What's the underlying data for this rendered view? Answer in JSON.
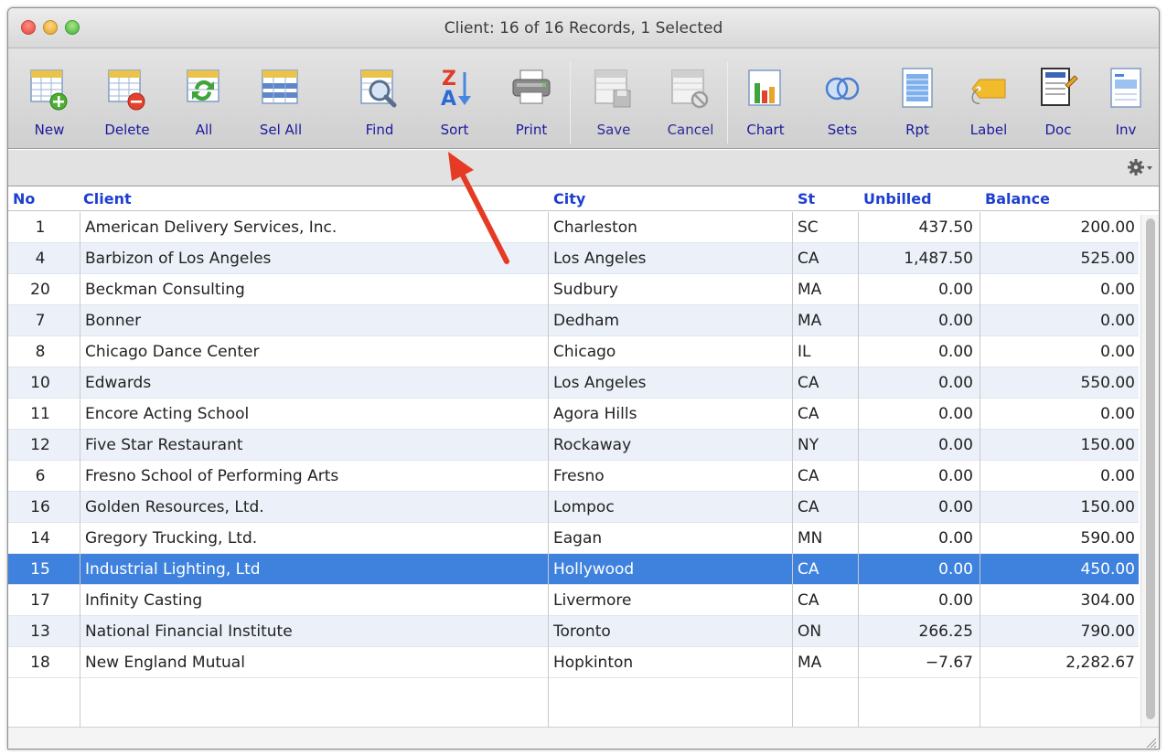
{
  "window": {
    "title": "Client: 16 of 16 Records, 1 Selected"
  },
  "toolbar": {
    "buttons": [
      {
        "label": "New",
        "icon": "new-record-icon"
      },
      {
        "label": "Delete",
        "icon": "delete-record-icon"
      },
      {
        "label": "All",
        "icon": "show-all-icon"
      },
      {
        "label": "Sel All",
        "icon": "select-all-icon"
      },
      {
        "label": "Find",
        "icon": "find-icon"
      },
      {
        "label": "Sort",
        "icon": "sort-az-icon"
      },
      {
        "label": "Print",
        "icon": "printer-icon"
      },
      {
        "label": "Save",
        "icon": "save-icon"
      },
      {
        "label": "Cancel",
        "icon": "cancel-icon"
      },
      {
        "label": "Chart",
        "icon": "chart-icon"
      },
      {
        "label": "Sets",
        "icon": "sets-icon"
      },
      {
        "label": "Rpt",
        "icon": "report-icon"
      },
      {
        "label": "Label",
        "icon": "label-tag-icon"
      },
      {
        "label": "Doc",
        "icon": "document-icon"
      },
      {
        "label": "Inv",
        "icon": "invoice-icon"
      }
    ]
  },
  "searchbar": {
    "gear_icon": "gear-icon"
  },
  "table": {
    "headers": [
      "No",
      "Client",
      "City",
      "St",
      "Unbilled",
      "Balance"
    ],
    "rows": [
      {
        "no": "1",
        "client": "American Delivery Services, Inc.",
        "city": "Charleston",
        "st": "SC",
        "unbilled": "437.50",
        "balance": "200.00"
      },
      {
        "no": "4",
        "client": "Barbizon of Los Angeles",
        "city": "Los Angeles",
        "st": "CA",
        "unbilled": "1,487.50",
        "balance": "525.00"
      },
      {
        "no": "20",
        "client": "Beckman Consulting",
        "city": "Sudbury",
        "st": "MA",
        "unbilled": "0.00",
        "balance": "0.00"
      },
      {
        "no": "7",
        "client": "Bonner",
        "city": "Dedham",
        "st": "MA",
        "unbilled": "0.00",
        "balance": "0.00"
      },
      {
        "no": "8",
        "client": "Chicago Dance Center",
        "city": "Chicago",
        "st": "IL",
        "unbilled": "0.00",
        "balance": "0.00"
      },
      {
        "no": "10",
        "client": "Edwards",
        "city": "Los Angeles",
        "st": "CA",
        "unbilled": "0.00",
        "balance": "550.00"
      },
      {
        "no": "11",
        "client": "Encore Acting School",
        "city": "Agora Hills",
        "st": "CA",
        "unbilled": "0.00",
        "balance": "0.00"
      },
      {
        "no": "12",
        "client": "Five Star Restaurant",
        "city": "Rockaway",
        "st": "NY",
        "unbilled": "0.00",
        "balance": "150.00"
      },
      {
        "no": "6",
        "client": "Fresno School of Performing Arts",
        "city": "Fresno",
        "st": "CA",
        "unbilled": "0.00",
        "balance": "0.00"
      },
      {
        "no": "16",
        "client": "Golden Resources, Ltd.",
        "city": "Lompoc",
        "st": "CA",
        "unbilled": "0.00",
        "balance": "150.00"
      },
      {
        "no": "14",
        "client": "Gregory Trucking, Ltd.",
        "city": "Eagan",
        "st": "MN",
        "unbilled": "0.00",
        "balance": "590.00"
      },
      {
        "no": "15",
        "client": "Industrial Lighting, Ltd",
        "city": "Hollywood",
        "st": "CA",
        "unbilled": "0.00",
        "balance": "450.00",
        "selected": true
      },
      {
        "no": "17",
        "client": "Infinity Casting",
        "city": "Livermore",
        "st": "CA",
        "unbilled": "0.00",
        "balance": "304.00"
      },
      {
        "no": "13",
        "client": "National Financial Institute",
        "city": "Toronto",
        "st": "ON",
        "unbilled": "266.25",
        "balance": "790.00"
      },
      {
        "no": "18",
        "client": "New England Mutual",
        "city": "Hopkinton",
        "st": "MA",
        "unbilled": "−7.67",
        "balance": "2,282.67"
      }
    ]
  },
  "colors": {
    "header_text": "#1d3fd0",
    "selected_row": "#3f82de",
    "alt_row": "#ecf1f9",
    "arrow": "#e53a23"
  }
}
